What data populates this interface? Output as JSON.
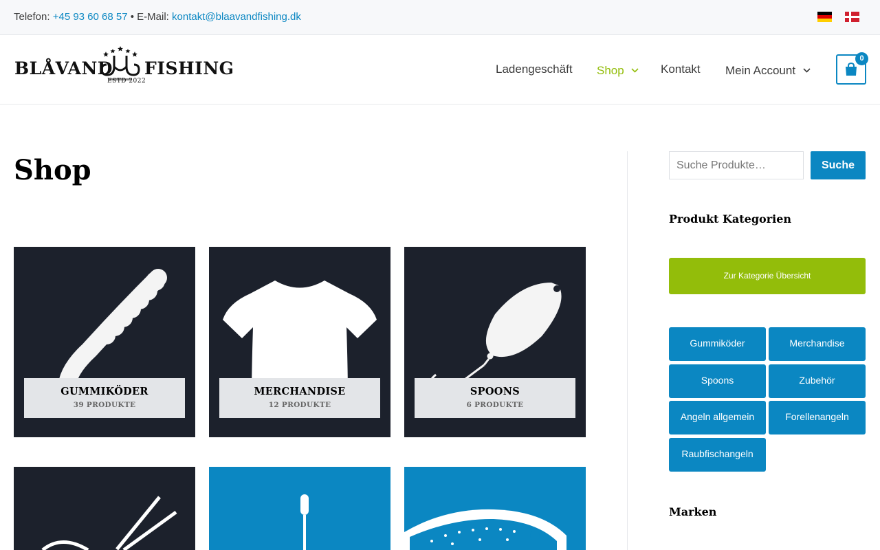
{
  "topbar": {
    "phone_label": "Telefon:",
    "phone": "+45 93 60 68 57",
    "separator": "• E-Mail:",
    "email": "kontakt@blaavandfishing.dk",
    "languages": [
      "de-flag-icon",
      "dk-flag-icon"
    ]
  },
  "logo": {
    "word_left": "BLÅVAND",
    "word_right": "FISHING",
    "est": "ESTD 2022"
  },
  "nav": {
    "items": [
      {
        "label": "Ladengeschäft",
        "has_dropdown": false,
        "active": false
      },
      {
        "label": "Shop",
        "has_dropdown": true,
        "active": true
      },
      {
        "label": "Kontakt",
        "has_dropdown": false,
        "active": false
      },
      {
        "label": "Mein Account",
        "has_dropdown": true,
        "active": false
      }
    ],
    "cart_count": "0"
  },
  "main": {
    "title": "Shop",
    "categories": [
      {
        "name": "GUMMIKÖDER",
        "count": "39 PRODUKTE",
        "icon": "soft-bait-icon"
      },
      {
        "name": "MERCHANDISE",
        "count": "12 PRODUKTE",
        "icon": "t-shirt-icon"
      },
      {
        "name": "SPOONS",
        "count": "6 PRODUKTE",
        "icon": "spoon-lure-icon"
      },
      {
        "name": "",
        "count": "",
        "icon": "scissors-icon"
      },
      {
        "name": "",
        "count": "",
        "icon": "rod-icon"
      },
      {
        "name": "",
        "count": "",
        "icon": "trout-icon"
      }
    ]
  },
  "sidebar": {
    "search_placeholder": "Suche Produkte…",
    "search_button": "Suche",
    "categories_title": "Produkt Kategorien",
    "overview_button": "Zur Kategorie Übersicht",
    "category_buttons": [
      "Gummiköder",
      "Merchandise",
      "Spoons",
      "Zubehör",
      "Angeln allgemein",
      "Forellenangeln",
      "Raubfischangeln"
    ],
    "brands_title": "Marken"
  },
  "colors": {
    "accent_blue": "#0b87c2",
    "accent_green": "#93bd0a",
    "tile_dark": "#1c212c"
  }
}
